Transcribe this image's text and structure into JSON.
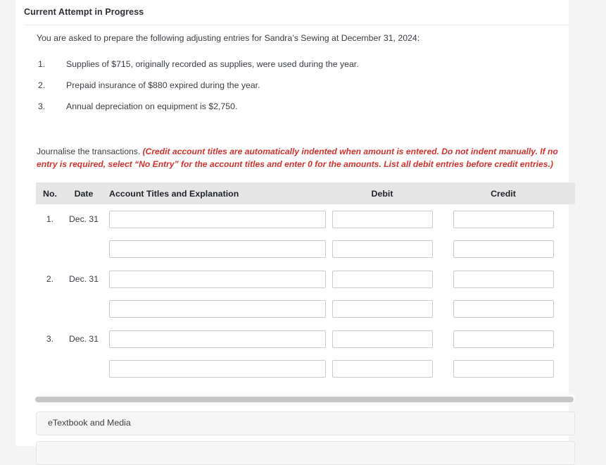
{
  "card": {
    "heading": "Current Attempt in Progress",
    "intro": "You are asked to prepare the following adjusting entries for Sandra’s Sewing at December 31, 2024:"
  },
  "adjustments": [
    {
      "num": "1.",
      "text": "Supplies of $715, originally recorded as supplies, were used during the year."
    },
    {
      "num": "2.",
      "text": "Prepaid insurance of $880 expired during the year."
    },
    {
      "num": "3.",
      "text": "Annual depreciation on equipment is $2,750."
    }
  ],
  "journalise": {
    "lead": "Journalise the transactions. ",
    "warning": "(Credit account titles are automatically indented when amount is entered. Do not indent manually. If no entry is required, select “No Entry” for the account titles and enter 0 for the amounts. List all debit entries before credit entries.)",
    "warning_color": "#d2322d"
  },
  "table": {
    "headers": {
      "no": "No.",
      "date": "Date",
      "account": "Account Titles and Explanation",
      "debit": "Debit",
      "credit": "Credit"
    },
    "header_bg": "#e6e6e6",
    "rows": [
      {
        "no": "1.",
        "date": "Dec. 31",
        "account_value": "",
        "account_placeholder": "",
        "debit_value": "",
        "debit_placeholder": "",
        "credit_value": "",
        "credit_placeholder": ""
      },
      {
        "no": "",
        "date": "",
        "account_value": "",
        "account_placeholder": "",
        "debit_value": "",
        "debit_placeholder": "",
        "credit_value": "",
        "credit_placeholder": ""
      },
      {
        "no": "2.",
        "date": "Dec. 31",
        "account_value": "",
        "account_placeholder": "",
        "debit_value": "",
        "debit_placeholder": "",
        "credit_value": "",
        "credit_placeholder": ""
      },
      {
        "no": "",
        "date": "",
        "account_value": "",
        "account_placeholder": "",
        "debit_value": "",
        "debit_placeholder": "",
        "credit_value": "",
        "credit_placeholder": ""
      },
      {
        "no": "3.",
        "date": "Dec. 31",
        "account_value": "",
        "account_placeholder": "",
        "debit_value": "",
        "debit_placeholder": "",
        "credit_value": "",
        "credit_placeholder": ""
      },
      {
        "no": "",
        "date": "",
        "account_value": "",
        "account_placeholder": "",
        "debit_value": "",
        "debit_placeholder": "",
        "credit_value": "",
        "credit_placeholder": ""
      }
    ]
  },
  "panels": {
    "etextbook_label": "eTextbook and Media"
  }
}
